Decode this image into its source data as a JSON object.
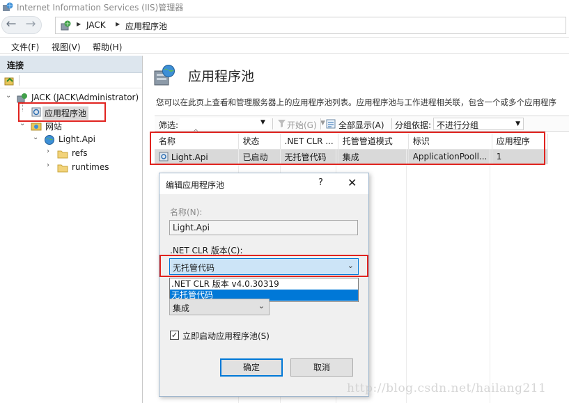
{
  "window": {
    "title": "Internet Information Services (IIS)管理器"
  },
  "address": {
    "crumbs": [
      "JACK",
      "应用程序池"
    ]
  },
  "menu": {
    "items": [
      "文件(F)",
      "视图(V)",
      "帮助(H)"
    ]
  },
  "connections": {
    "header": "连接",
    "tree": [
      {
        "label": "JACK (JACK\\Administrator)",
        "icon": "server-icon"
      },
      {
        "label": "应用程序池",
        "icon": "app-pool-icon",
        "selected": true
      },
      {
        "label": "网站",
        "icon": "sites-folder-icon"
      },
      {
        "label": "Light.Api",
        "icon": "globe-icon"
      },
      {
        "label": "refs",
        "icon": "folder-icon"
      },
      {
        "label": "runtimes",
        "icon": "folder-icon"
      }
    ]
  },
  "main": {
    "title": "应用程序池",
    "description": "您可以在此页上查看和管理服务器上的应用程序池列表。应用程序池与工作进程相关联，包含一个或多个应用程序",
    "filter": {
      "label": "筛选:",
      "start": "开始(G)",
      "show_all": "全部显示(A)",
      "group_label": "分组依据:",
      "group_value": "不进行分组"
    },
    "table": {
      "columns": [
        "名称",
        "状态",
        ".NET CLR ...",
        "托管管道模式",
        "标识",
        "应用程序"
      ],
      "rows": [
        [
          "Light.Api",
          "已启动",
          "无托管代码",
          "集成",
          "ApplicationPooll...",
          "1"
        ]
      ]
    }
  },
  "dialog": {
    "title": "编辑应用程序池",
    "help": "?",
    "close": "✕",
    "name_label": "名称(N):",
    "name_value": "Light.Api",
    "clr_label": ".NET CLR 版本(C):",
    "clr_selected": "无托管代码",
    "clr_options": [
      ".NET CLR 版本 v4.0.30319",
      "无托管代码"
    ],
    "pipeline_value": "集成",
    "autostart_label": "立即启动应用程序池(S)",
    "autostart_checked": "✓",
    "ok": "确定",
    "cancel": "取消"
  },
  "watermark": "http://blog.csdn.net/hailang211",
  "colors": {
    "highlight": "#e0231f",
    "selection": "#0078d7"
  }
}
